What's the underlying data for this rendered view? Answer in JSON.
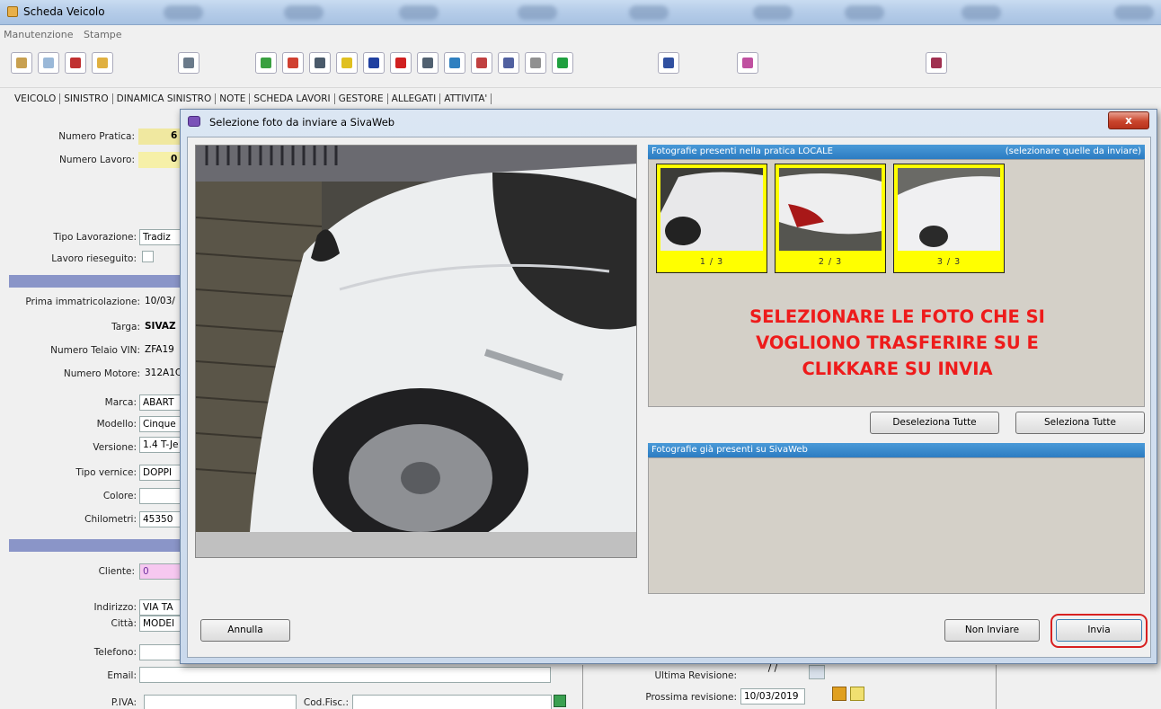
{
  "app": {
    "title": "Scheda Veicolo",
    "menu": [
      "Manutenzione",
      "Stampe"
    ],
    "tabs": [
      "VEICOLO",
      "SINISTRO",
      "DINAMICA SINISTRO",
      "NOTE",
      "SCHEDA LAVORI",
      "GESTORE",
      "ALLEGATI",
      "ATTIVITA'"
    ]
  },
  "form": {
    "numero_pratica_label": "Numero Pratica:",
    "numero_pratica_value": "6",
    "numero_lavoro_label": "Numero Lavoro:",
    "numero_lavoro_value": "0",
    "tipo_lavorazione_label": "Tipo Lavorazione:",
    "tipo_lavorazione_value": "Tradiz",
    "lavoro_rieseguito_label": "Lavoro rieseguito:",
    "prima_immatricolazione_label": "Prima immatricolazione:",
    "prima_immatricolazione_value": "10/03/",
    "targa_label": "Targa:",
    "targa_value": "SIVAZ",
    "telaio_label": "Numero Telaio VIN:",
    "telaio_value": "ZFA19",
    "motore_label": "Numero Motore:",
    "motore_value": "312A1C",
    "marca_label": "Marca:",
    "marca_value": "ABART",
    "modello_label": "Modello:",
    "modello_value": "Cinque",
    "versione_label": "Versione:",
    "versione_value": "1.4 T-Je",
    "vernice_label": "Tipo vernice:",
    "vernice_value": "DOPPI",
    "colore_label": "Colore:",
    "chilometri_label": "Chilometri:",
    "chilometri_value": "45350",
    "cliente_label": "Cliente:",
    "cliente_value": "0",
    "indirizzo_label": "Indirizzo:",
    "indirizzo_value": "VIA TA",
    "citta_label": "Città:",
    "citta_value": "MODEI",
    "telefono_label": "Telefono:",
    "email_label": "Email:",
    "piva_label": "P.IVA:",
    "codfisc_label": "Cod.Fisc.:",
    "ultima_revisione_label": "Ultima Revisione:",
    "ultima_revisione_value": "/ /",
    "prossima_revisione_label": "Prossima revisione:",
    "prossima_revisione_value": "10/03/2019"
  },
  "dialog": {
    "title": "Selezione foto da inviare a SivaWeb",
    "close_label": "x",
    "local_header": "Fotografie presenti nella pratica LOCALE",
    "local_hint": "(selezionare quelle da inviare)",
    "thumbnails": [
      {
        "label": "1 / 3",
        "selected": true
      },
      {
        "label": "2 / 3",
        "selected": true
      },
      {
        "label": "3 / 3",
        "selected": true
      }
    ],
    "notice": "SELEZIONARE LE FOTO CHE SI VOGLIONO TRASFERIRE SU E CLIKKARE SU INVIA",
    "deselect_all": "Deseleziona Tutte",
    "select_all": "Seleziona Tutte",
    "remote_header": "Fotografie già presenti su SivaWeb",
    "cancel": "Annulla",
    "dont_send": "Non Inviare",
    "send": "Invia"
  },
  "colors": {
    "notice_red": "#ee1b1b",
    "thumb_selected": "#ffff00",
    "panel_header_blue": "#2c7cc2",
    "highlight_ring": "#d82020"
  }
}
